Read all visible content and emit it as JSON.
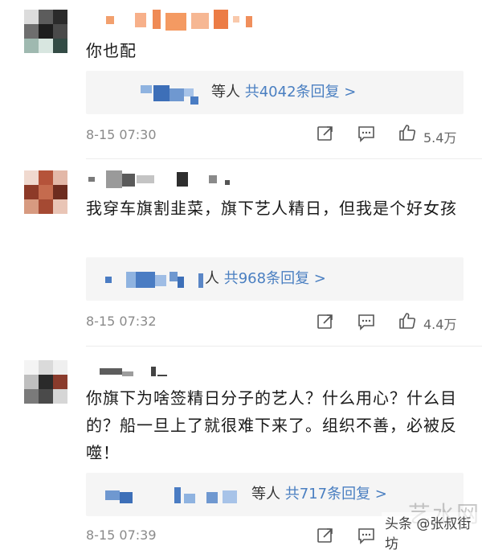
{
  "comments": [
    {
      "text": "你也配",
      "reply_suffix": "等人",
      "reply_link": "共4042条回复 >",
      "time": "8-15 07:30",
      "likes": "5.4万"
    },
    {
      "text": "我穿车旗割韭菜，旗下艺人精日，但我是个好女孩",
      "reply_suffix": "人",
      "reply_link": "共968条回复 >",
      "time": "8-15 07:32",
      "likes": "4.4万"
    },
    {
      "text": "你旗下为啥签精日分子的艺人？什么用心？什么目的？船一旦上了就很难下来了。组织不善，必被反噬！",
      "reply_suffix": "等人",
      "reply_link": "共717条回复 >",
      "time": "8-15 07:39",
      "likes": ""
    }
  ],
  "icons": {
    "share": "share-icon",
    "comment": "comment-icon",
    "like": "thumbs-up-icon"
  },
  "colors": {
    "link": "#4a7fc1",
    "time": "#8a8a8a",
    "reply_bg": "#f5f5f5"
  },
  "watermark": {
    "text": "头条 @张叔街坊",
    "logo": "艺水网"
  }
}
